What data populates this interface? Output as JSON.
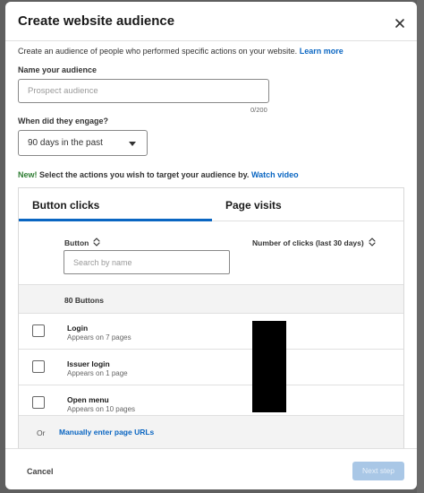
{
  "modal": {
    "title": "Create website audience",
    "intro_text": "Create an audience of people who performed specific actions on your website.",
    "learn_more": "Learn more"
  },
  "name_field": {
    "label": "Name your audience",
    "placeholder": "Prospect audience",
    "value": "",
    "counter": "0/200"
  },
  "engage": {
    "label": "When did they engage?",
    "selected": "90 days in the past"
  },
  "actions_line": {
    "new": "New!",
    "text": "Select the actions you wish to target your audience by.",
    "link": "Watch video"
  },
  "tabs": [
    {
      "label": "Button clicks",
      "active": true
    },
    {
      "label": "Page visits",
      "active": false
    }
  ],
  "table": {
    "col_button": "Button",
    "col_clicks": "Number of clicks (last 30 days)",
    "search_placeholder": "Search by name",
    "count_label": "80 Buttons",
    "rows": [
      {
        "name": "Login",
        "sub": "Appears on 7 pages",
        "checked": false
      },
      {
        "name": "Issuer login",
        "sub": "Appears on 1 page",
        "checked": false
      },
      {
        "name": "Open menu",
        "sub": "Appears on 10 pages",
        "checked": false
      }
    ]
  },
  "manual": {
    "or": "Or",
    "link": "Manually enter page URLs"
  },
  "footer": {
    "cancel": "Cancel",
    "next": "Next step"
  },
  "colors": {
    "accent": "#0a66c2",
    "new_green": "#2e7d32",
    "disabled_button": "#a9c7e6"
  }
}
